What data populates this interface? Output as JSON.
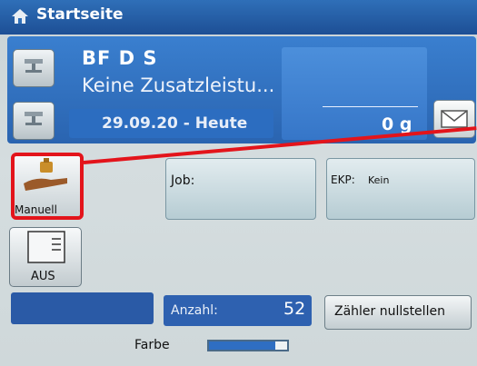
{
  "header": {
    "title": "Startseite",
    "icon": "home-icon"
  },
  "info": {
    "line1": "BF D S",
    "line2": "Keine Zusatzleistu...",
    "date": "29.09.20 - Heute",
    "weight": "0 g"
  },
  "buttons": {
    "manuell": "Manuell",
    "aus": "AUS",
    "zaehler": "Zähler nullstellen"
  },
  "tiles": {
    "job": "Job:",
    "ekp_label": "EKP:",
    "ekp_value": "Kein"
  },
  "counter": {
    "label": "Anzahl:",
    "value": "52"
  },
  "color": {
    "label": "Farbe",
    "level": 0.85
  },
  "colors": {
    "highlight": "#e3141b",
    "panel": "#2a64b0",
    "header": "#1d4f95"
  }
}
